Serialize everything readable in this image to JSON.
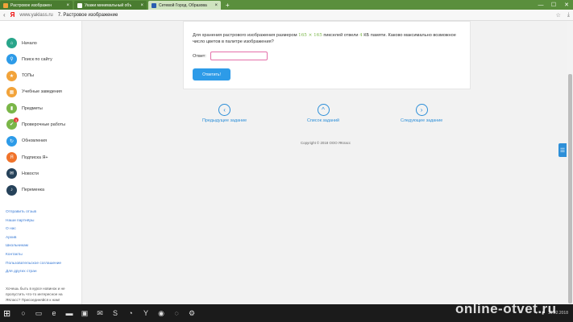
{
  "browser": {
    "tabs": [
      {
        "label": "Растровое изображен",
        "favicon_color": "#f2a33a",
        "active": false
      },
      {
        "label": "Укажи минимальный объ",
        "favicon_color": "#ffffff",
        "active": false
      },
      {
        "label": "Сетевой Город. Образова",
        "favicon_color": "#2a5db0",
        "active": true
      }
    ],
    "new_tab_glyph": "+",
    "window_controls": [
      "—",
      "☐",
      "✕"
    ],
    "address": {
      "back_glyph": "‹",
      "logo": "Я",
      "domain": "www.yaklass.ru",
      "page_title": "7. Растровое изображение",
      "bookmark_glyph": "☆",
      "download_glyph": "⤓"
    }
  },
  "sidebar": {
    "menu": [
      {
        "label": "Начало",
        "icon": "home-icon",
        "glyph": "⌂",
        "color": "#28a58a"
      },
      {
        "label": "Поиск по сайту",
        "icon": "search-icon",
        "glyph": "⚲",
        "color": "#2d9be8"
      },
      {
        "label": "ТОПы",
        "icon": "star-icon",
        "glyph": "★",
        "color": "#f2a33a"
      },
      {
        "label": "Учебные заведения",
        "icon": "school-icon",
        "glyph": "▦",
        "color": "#f2a33a"
      },
      {
        "label": "Предметы",
        "icon": "books-icon",
        "glyph": "▮",
        "color": "#7ab648"
      },
      {
        "label": "Проверочные работы",
        "icon": "check-icon",
        "glyph": "✔",
        "color": "#7ab648",
        "badge": "3"
      },
      {
        "label": "Обновления",
        "icon": "refresh-icon",
        "glyph": "↻",
        "color": "#2d9be8"
      },
      {
        "label": "Подписка Я+",
        "icon": "subscription-icon",
        "glyph": "Я",
        "color": "#f0732a"
      },
      {
        "label": "Новости",
        "icon": "news-icon",
        "glyph": "✉",
        "color": "#26425a"
      },
      {
        "label": "Переменка",
        "icon": "bell-icon",
        "glyph": "♪",
        "color": "#26425a"
      }
    ],
    "links": [
      "Отправить отзыв",
      "Наши партнёры",
      "О нас",
      "Архив",
      "Школьникам",
      "Контакты",
      "Пользовательское соглашение",
      "Для других стран"
    ],
    "promo": "Хочешь быть в курсе новинок и не пропустить что-то интересное на ЯКласс? Присоединяйся к нам!"
  },
  "task": {
    "question_before": "Для хранения растрового изображения размером ",
    "size": "165 × 165",
    "question_middle": " пикселей отвели ",
    "memory": "4",
    "question_after": " КБ памяти. Каково максимально возможное число цветов в палитре изображения?",
    "answer_label": "Ответ:",
    "answer_value": "",
    "submit_label": "Ответить!"
  },
  "navigation": {
    "prev": {
      "label": "Предыдущее задание",
      "glyph": "‹"
    },
    "list": {
      "label": "Список заданий",
      "glyph": "^"
    },
    "next": {
      "label": "Следующее задание",
      "glyph": "›"
    }
  },
  "footer": {
    "copyright": "Copyright © 2018 ООО ЯКласс"
  },
  "feedback_tab_glyph": "☰",
  "taskbar": {
    "start_glyph": "⊞",
    "apps": [
      {
        "icon": "search-icon",
        "glyph": "○"
      },
      {
        "icon": "task-view-icon",
        "glyph": "▭"
      },
      {
        "icon": "edge-icon",
        "glyph": "e"
      },
      {
        "icon": "folder-icon",
        "glyph": "▬"
      },
      {
        "icon": "store-icon",
        "glyph": "▣"
      },
      {
        "icon": "mail-icon",
        "glyph": "✉"
      },
      {
        "icon": "skype-icon",
        "glyph": "S"
      },
      {
        "icon": "whatsapp-icon",
        "glyph": "◔"
      },
      {
        "icon": "yandex-browser-icon",
        "glyph": "Y"
      },
      {
        "icon": "chrome-icon",
        "glyph": "◉"
      },
      {
        "icon": "viber-icon",
        "glyph": "◌"
      },
      {
        "icon": "app-icon",
        "glyph": "⚙"
      }
    ],
    "tray_glyphs": [
      "⌃",
      "♪",
      "▮"
    ],
    "date": "10.02.2018"
  },
  "watermark": "online-otvet.ru"
}
